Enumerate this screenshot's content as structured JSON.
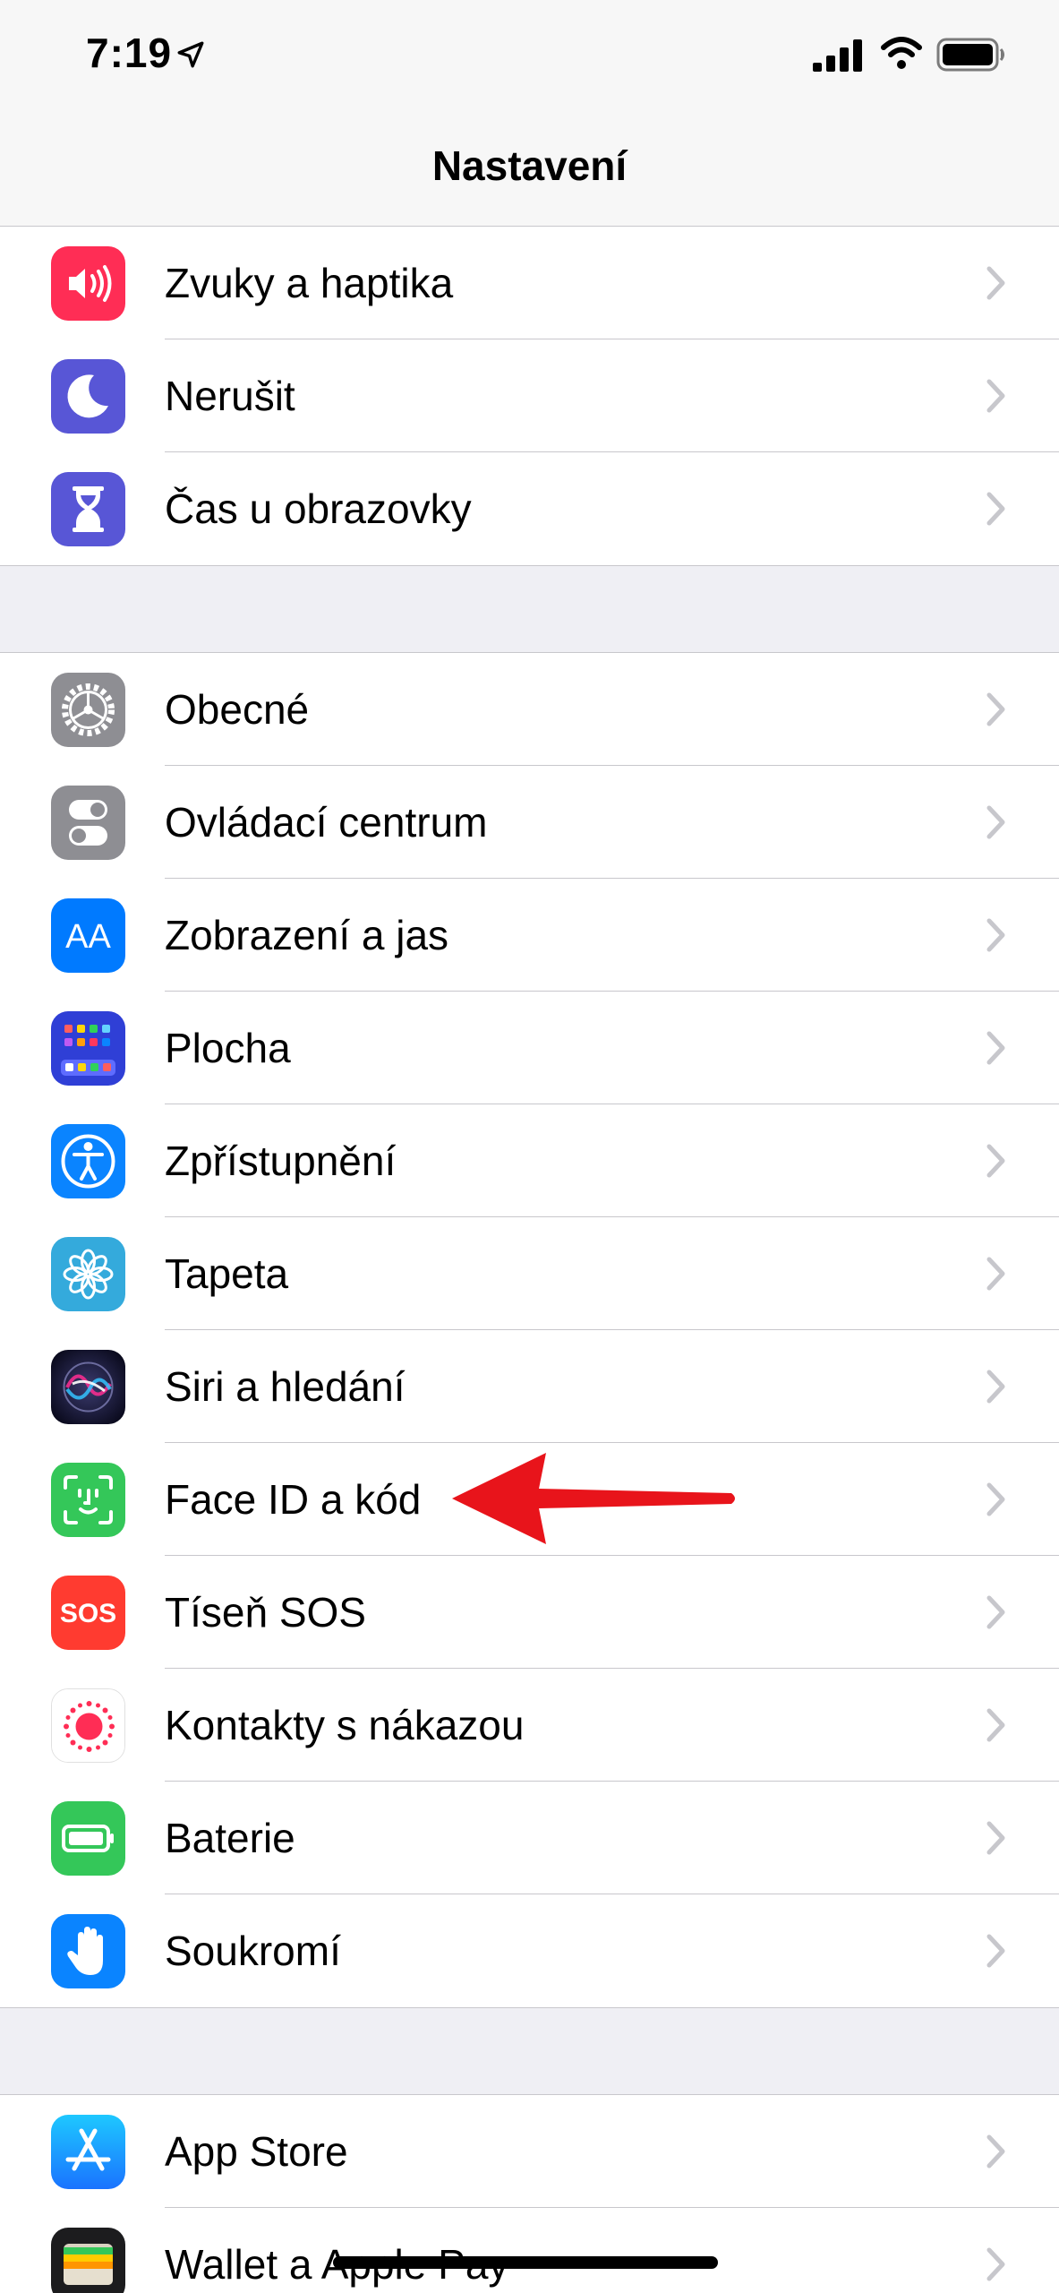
{
  "status_bar": {
    "time": "7:19",
    "location_icon": "location-arrow-icon",
    "signal_icon": "cellular-signal-icon",
    "wifi_icon": "wifi-icon",
    "battery_icon": "battery-icon"
  },
  "header": {
    "title": "Nastavení"
  },
  "groups": [
    {
      "items": [
        {
          "label": "Zvuky a haptika",
          "icon": "sounds-icon",
          "color": "#ff2d55"
        },
        {
          "label": "Nerušit",
          "icon": "moon-icon",
          "color": "#5856d6"
        },
        {
          "label": "Čas u obrazovky",
          "icon": "hourglass-icon",
          "color": "#5856d6"
        }
      ]
    },
    {
      "items": [
        {
          "label": "Obecné",
          "icon": "gear-icon",
          "color": "#8e8e93"
        },
        {
          "label": "Ovládací centrum",
          "icon": "toggles-icon",
          "color": "#8e8e93"
        },
        {
          "label": "Zobrazení a jas",
          "icon": "text-size-icon",
          "color": "#007aff",
          "glyph": "AA"
        },
        {
          "label": "Plocha",
          "icon": "home-screen-grid-icon",
          "color": "#2f3fd6"
        },
        {
          "label": "Zpřístupnění",
          "icon": "accessibility-icon",
          "color": "#0a84ff"
        },
        {
          "label": "Tapeta",
          "icon": "flower-icon",
          "color": "#34aadc"
        },
        {
          "label": "Siri a hledání",
          "icon": "siri-icon",
          "color": "#1c1c3a"
        },
        {
          "label": "Face ID a kód",
          "icon": "face-id-icon",
          "color": "#34c759"
        },
        {
          "label": "Tíseň SOS",
          "icon": "sos-icon",
          "color": "#ff3b30",
          "glyph": "SOS"
        },
        {
          "label": "Kontakty s nákazou",
          "icon": "exposure-notification-icon",
          "color": "#ffffff"
        },
        {
          "label": "Baterie",
          "icon": "battery-icon",
          "color": "#34c759"
        },
        {
          "label": "Soukromí",
          "icon": "hand-icon",
          "color": "#0a84ff"
        }
      ]
    },
    {
      "items": [
        {
          "label": "App Store",
          "icon": "app-store-icon",
          "color": "#0a84ff"
        },
        {
          "label": "Wallet a Apple Pay",
          "icon": "wallet-icon",
          "color": "#1c1c1e"
        }
      ]
    }
  ],
  "annotation": {
    "icon": "red-arrow-icon",
    "color": "#e8141b"
  }
}
